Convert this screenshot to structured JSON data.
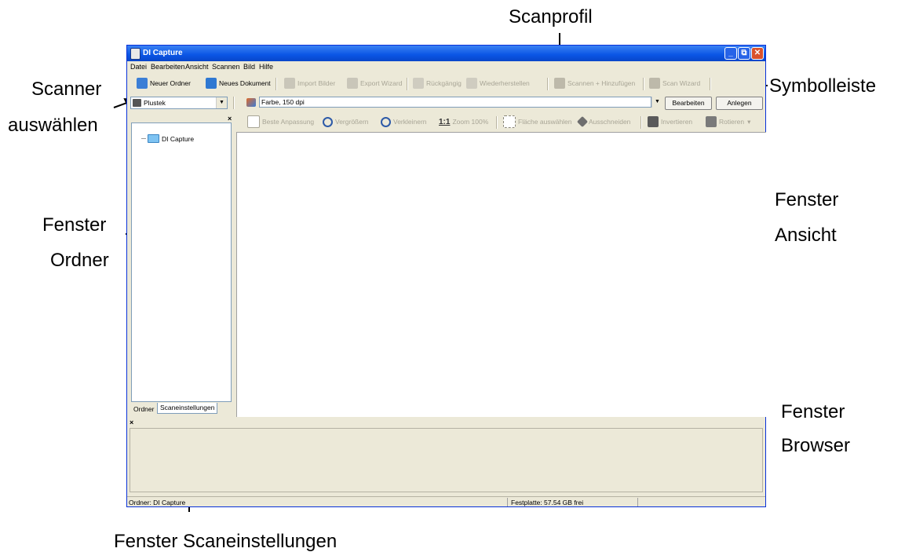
{
  "window": {
    "title": "DI Capture",
    "minimize": "_",
    "maximize": "⧉",
    "close": "✕",
    "menus": [
      "Datei",
      "Bearbeiten",
      "Ansicht",
      "Scannen",
      "Bild",
      "Hilfe"
    ]
  },
  "toolbar": {
    "new_folder": "Neuer Ordner",
    "new_document": "Neues Dokument",
    "import_images": "Import Bilder",
    "export_wizard": "Export Wizard",
    "undo": "Rückgängig",
    "redo": "Wiederherstellen",
    "scan_add": "Scannen + Hinzufügen",
    "scan_wizard": "Scan Wizard"
  },
  "scanner_select": {
    "value": "Plustek"
  },
  "profile_select": {
    "value": "Farbe, 150 dpi"
  },
  "buttons": {
    "edit": "Bearbeiten",
    "create": "Anlegen"
  },
  "view_toolbar": {
    "best_fit": "Beste Anpassung",
    "zoom_in": "Vergrößern",
    "zoom_out": "Verkleinern",
    "zoom_100_symbol": "1:1",
    "zoom_100": "Zoom 100%",
    "select_area": "Fläche auswählen",
    "crop": "Ausschneiden",
    "invert": "Invertieren",
    "rotate": "Rotieren",
    "rotate_arrow": "▾"
  },
  "folder_tree": {
    "root": "DI Capture"
  },
  "left_tabs": [
    "Ordner",
    "Scaneinstellungen"
  ],
  "pane_close": "×",
  "status": {
    "folder": "Ordner: DI Capture",
    "disk": "Festplatte: 57.54 GB frei"
  },
  "callouts": {
    "scanprofil": "Scanprofil",
    "symbolleiste": "Symbolleiste",
    "scanner": "Scanner",
    "auswaehlen": "auswählen",
    "fenster_ordner_1": "Fenster",
    "fenster_ordner_2": "Ordner",
    "fenster_ansicht_1": "Fenster",
    "fenster_ansicht_2": "Ansicht",
    "fenster_browser_1": "Fenster",
    "fenster_browser_2": "Browser",
    "fenster_scaneinstellungen": "Fenster Scaneinstellungen"
  },
  "colors": {
    "titlebar": "#0a55e5",
    "window_bg": "#ece9d8",
    "folder": "#7ec3f2"
  }
}
